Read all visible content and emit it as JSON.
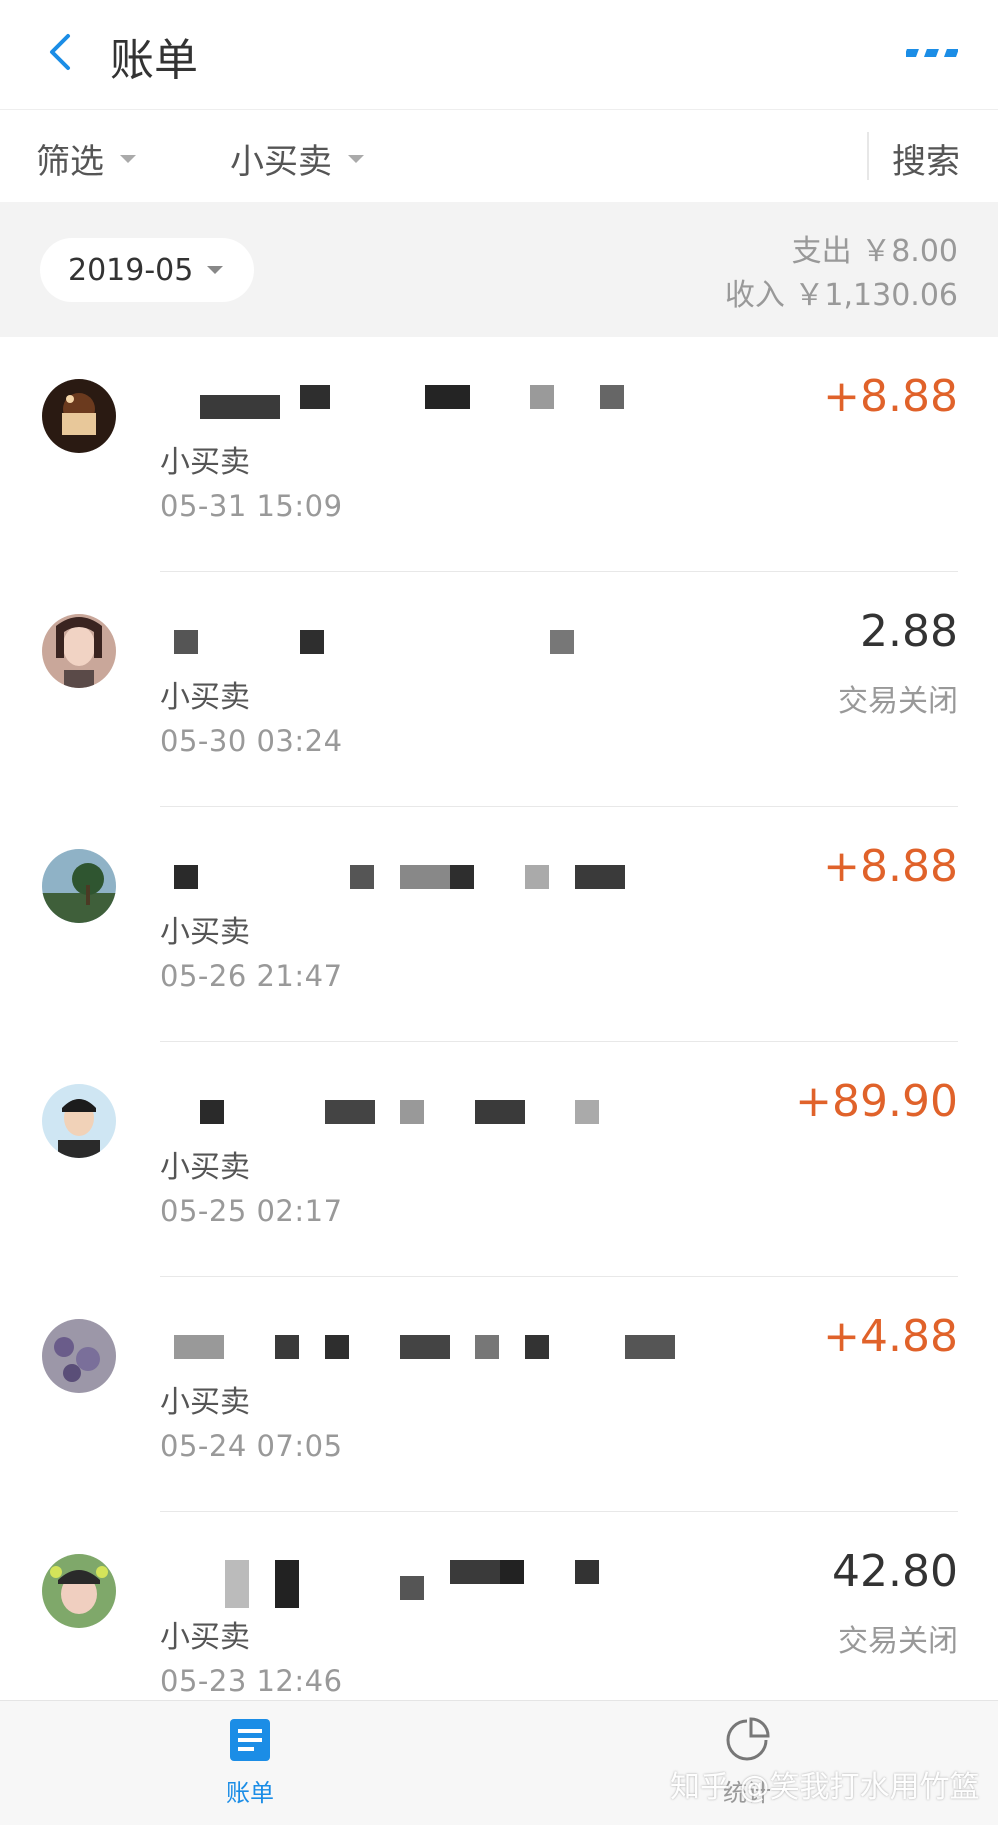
{
  "header": {
    "title": "账单",
    "back_icon": "chevron-left-icon",
    "more_icon": "more-dots-icon",
    "accent": "#1b8de6"
  },
  "filters": {
    "screen_label": "筛选",
    "category_label": "小买卖",
    "search_label": "搜索"
  },
  "summary": {
    "month": "2019-05",
    "expense": "支出 ￥8.00",
    "income": "收入 ￥1,130.06"
  },
  "transactions": [
    {
      "category": "小买卖",
      "time": "05-31  15:09",
      "amount": "+8.88",
      "status": "",
      "type": "income"
    },
    {
      "category": "小买卖",
      "time": "05-30  03:24",
      "amount": "2.88",
      "status": "交易关闭",
      "type": "closed"
    },
    {
      "category": "小买卖",
      "time": "05-26  21:47",
      "amount": "+8.88",
      "status": "",
      "type": "income"
    },
    {
      "category": "小买卖",
      "time": "05-25  02:17",
      "amount": "+89.90",
      "status": "",
      "type": "income"
    },
    {
      "category": "小买卖",
      "time": "05-24  07:05",
      "amount": "+4.88",
      "status": "",
      "type": "income"
    },
    {
      "category": "小买卖",
      "time": "05-23  12:46",
      "amount": "42.80",
      "status": "交易关闭",
      "type": "closed"
    }
  ],
  "tabbar": {
    "bills_label": "账单",
    "stats_label": "统计",
    "bills_icon": "document-icon",
    "stats_icon": "pie-chart-icon"
  },
  "watermark": "知乎 @笑我打水用竹篮",
  "colors": {
    "income": "#e0622a",
    "closed": "#333333",
    "muted": "#999999"
  }
}
